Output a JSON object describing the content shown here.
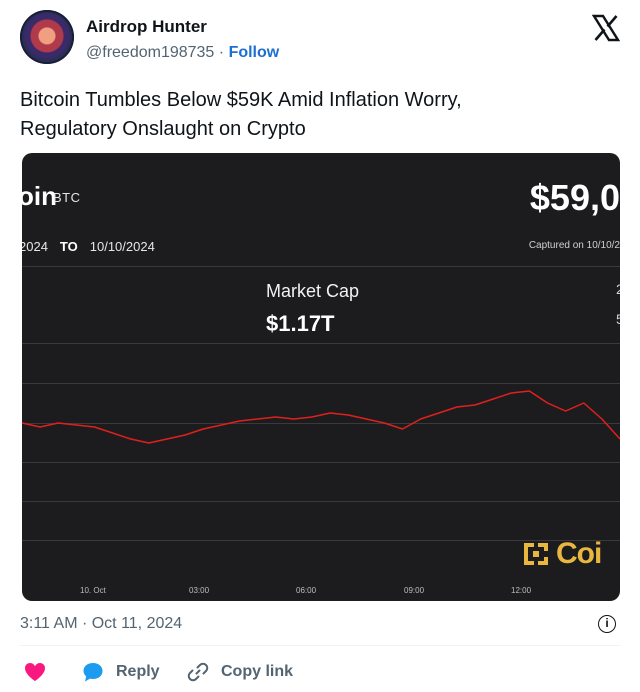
{
  "header": {
    "display_name": "Airdrop Hunter",
    "handle": "@freedom198735",
    "separator": "·",
    "follow_label": "Follow",
    "brand_icon": "x-logo-icon"
  },
  "tweet": {
    "text_line1": "Bitcoin Tumbles Below $59K Amid Inflation Worry,",
    "text_line2": "Regulatory Onslaught on Crypto",
    "timestamp": "3:11 AM · Oct 11, 2024"
  },
  "chart_image": {
    "coin_name_partial": "oin",
    "ticker": "BTC",
    "price_partial": "$59,0",
    "range_start_partial": "2024",
    "range_to": "TO",
    "range_end": "10/10/2024",
    "captured_partial": "Captured on 10/10/2",
    "market_cap_label": "Market Cap",
    "market_cap_value": "$1.17T",
    "watermark_partial": "Coi",
    "line_color": "#e0201c",
    "watermark_color": "#e8b740",
    "x_ticks": [
      "10. Oct",
      "03:00",
      "06:00",
      "09:00",
      "12:00"
    ]
  },
  "chart_data": {
    "type": "line",
    "title": "",
    "xlabel": "",
    "ylabel": "",
    "x_tick_labels": [
      "10. Oct",
      "03:00",
      "06:00",
      "09:00",
      "12:00"
    ],
    "series": [
      {
        "values": [
          50,
          49,
          50,
          49.5,
          49,
          47.5,
          46,
          45,
          46,
          47,
          48.5,
          49.5,
          50.5,
          51,
          51.5,
          51,
          51.5,
          52.5,
          52,
          51,
          50,
          48.5,
          51,
          52.5,
          54,
          54.5,
          56,
          57.5,
          58,
          55,
          53,
          55,
          51,
          46
        ]
      }
    ]
  },
  "actions": {
    "like_icon": "heart-icon",
    "reply_icon": "speech-bubble-icon",
    "reply_label": "Reply",
    "copy_icon": "link-icon",
    "copy_label": "Copy link",
    "info_glyph": "i"
  },
  "colors": {
    "accent_blue": "#1d6fd1",
    "like_pink": "#f91880",
    "reply_blue": "#1d9bf0",
    "chart_bg": "#1c1c1e"
  }
}
